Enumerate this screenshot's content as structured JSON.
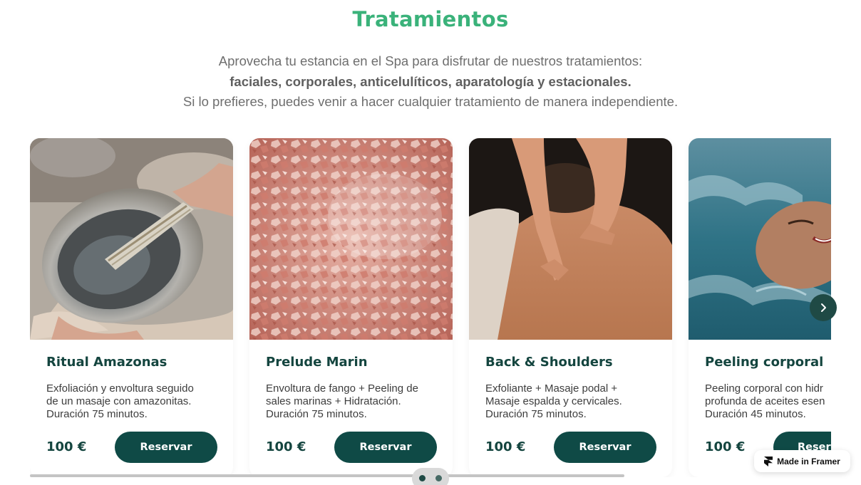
{
  "section": {
    "title": "Tratamientos",
    "intro_line1": "Aprovecha tu estancia en el Spa para disfrutar de nuestros tratamientos:",
    "intro_line2": "faciales, corporales, anticelulíticos, aparatología y estacionales.",
    "intro_line3": "Si lo prefieres, puedes venir a hacer cualquier tratamiento de manera independiente."
  },
  "cards": [
    {
      "name": "Ritual Amazonas",
      "desc1": "Exfoliación y envoltura seguido",
      "desc2": "de un masaje con amazonitas.",
      "desc3": "Duración 75 minutos.",
      "price": "100 €",
      "button": "Reservar",
      "image": "abalone-shell-sage-photo"
    },
    {
      "name": "Prelude Marin",
      "desc1": "Envoltura de fango + Peeling de",
      "desc2": "sales marinas + Hidratación.",
      "desc3": "Duración 75 minutos.",
      "price": "100 €",
      "button": "Reservar",
      "image": "pink-salt-crystals-photo"
    },
    {
      "name": "Back & Shoulders",
      "desc1": "Exfoliante + Masaje podal +",
      "desc2": "Masaje espalda y cervicales.",
      "desc3": "Duración 75 minutos.",
      "price": "100 €",
      "button": "Reservar",
      "image": "back-massage-photo"
    },
    {
      "name": "Peeling corporal",
      "desc1": "Peeling corporal con hidr",
      "desc2": "profunda de aceites esen",
      "desc3": "Duración 45 minutos.",
      "price": "100 €",
      "button": "Reser",
      "image": "woman-in-water-photo"
    }
  ],
  "carousel": {
    "next_icon": "chevron-right-icon",
    "pages": 2,
    "active_page": 1
  },
  "badge": {
    "label": "Made in Framer",
    "icon": "framer-logo-icon"
  },
  "colors": {
    "title": "#3ab27a",
    "brand_dark": "#0f4a46",
    "text": "#3d3d3d"
  }
}
